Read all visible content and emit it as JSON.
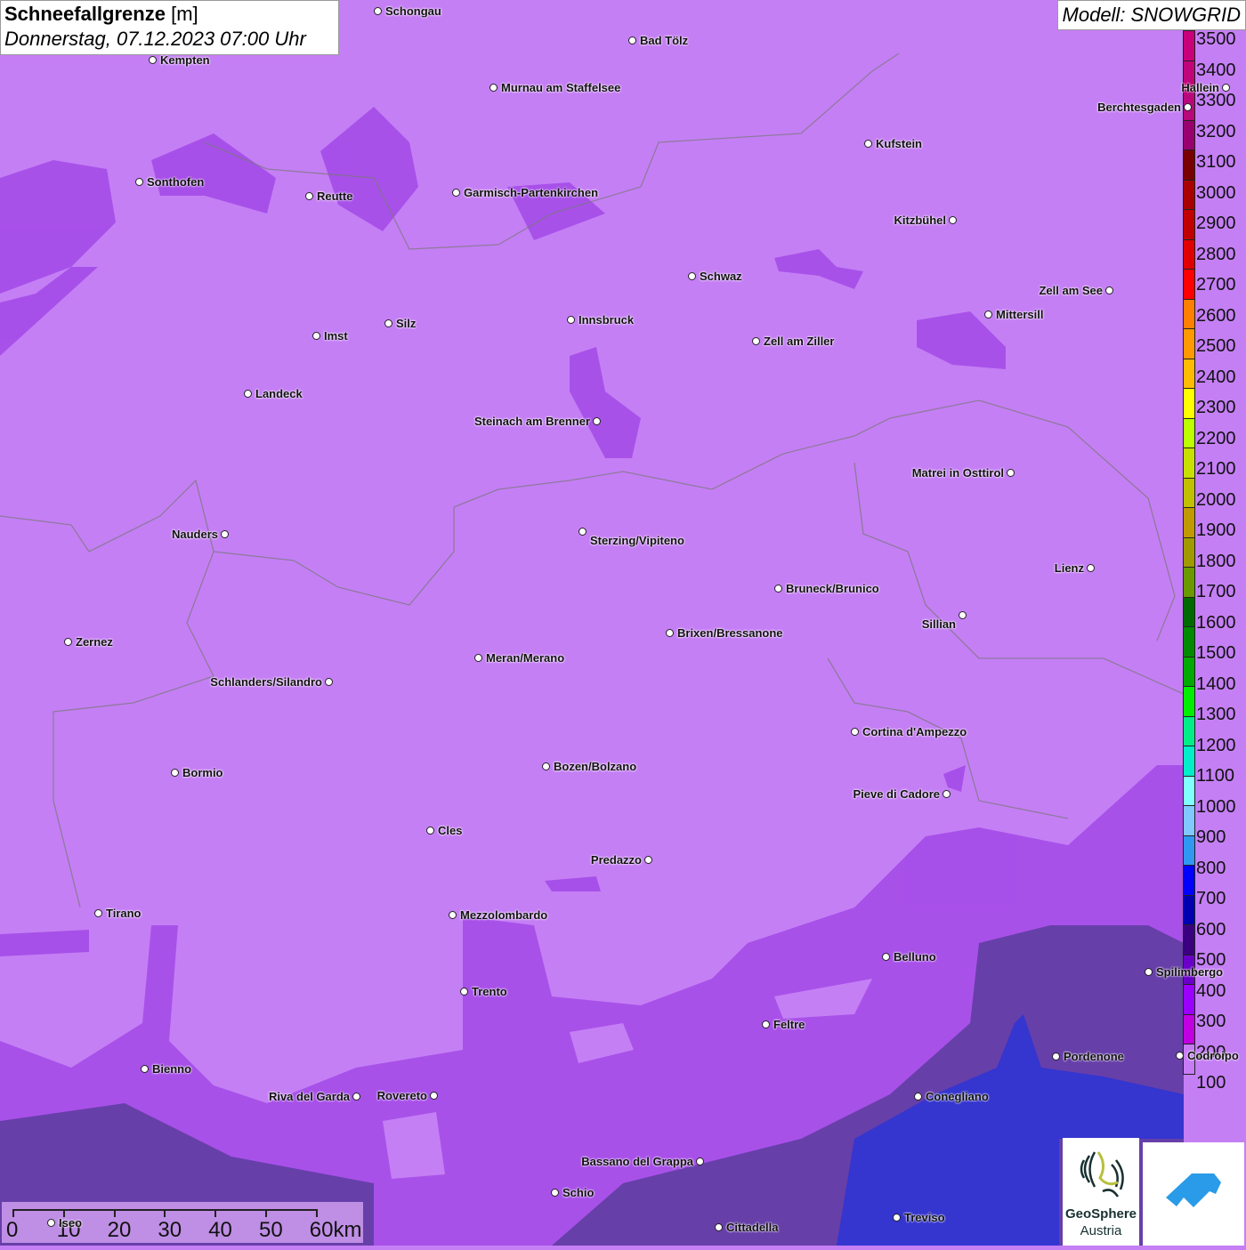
{
  "title": {
    "variable": "Schneefallgrenze",
    "unit": "[m]",
    "datetime": "Donnerstag, 07.12.2023 07:00 Uhr"
  },
  "model": "Modell: SNOWGRID",
  "legend": {
    "labels": [
      "3500",
      "3400",
      "3300",
      "3200",
      "3100",
      "3000",
      "2900",
      "2800",
      "2700",
      "2600",
      "2500",
      "2400",
      "2300",
      "2200",
      "2100",
      "2000",
      "1900",
      "1800",
      "1700",
      "1600",
      "1500",
      "1400",
      "1300",
      "1200",
      "1100",
      "1000",
      "900",
      "800",
      "700",
      "600",
      "500",
      "400",
      "300",
      "200",
      "100"
    ],
    "colors": [
      "#c8007a",
      "#c0057a",
      "#b8087a",
      "#98006e",
      "#780000",
      "#a80000",
      "#c00000",
      "#e00000",
      "#ff0000",
      "#ff7f00",
      "#ff9900",
      "#ffbb00",
      "#ffff00",
      "#bbff00",
      "#c8e000",
      "#c0c000",
      "#c09a00",
      "#a09a00",
      "#6a9a00",
      "#006a00",
      "#008a00",
      "#00aa00",
      "#00ee00",
      "#00ee88",
      "#00eec8",
      "#80ffff",
      "#80c8ff",
      "#3098f0",
      "#0000ff",
      "#0000b0",
      "#3a0080",
      "#6a00c8",
      "#9a00ff",
      "#c000e0",
      "#c77cf7"
    ]
  },
  "cities": [
    "Schongau",
    "Bad Tölz",
    "Kempten",
    "Murnau am Staffelsee",
    "Hallein",
    "Berchtesgaden",
    "Kufstein",
    "Sonthofen",
    "Reutte",
    "Garmisch-Partenkirchen",
    "Kitzbühel",
    "Schwaz",
    "Zell am See",
    "Innsbruck",
    "Mittersill",
    "Silz",
    "Imst",
    "Zell am Ziller",
    "Landeck",
    "Steinach am Brenner",
    "Matrei in Osttirol",
    "Nauders",
    "Sterzing/Vipiteno",
    "Lienz",
    "Bruneck/Brunico",
    "Sillian",
    "Brixen/Bressanone",
    "Zernez",
    "Meran/Merano",
    "Schlanders/Silandro",
    "Cortina d'Ampezzo",
    "Bozen/Bolzano",
    "Bormio",
    "Pieve di Cadore",
    "Cles",
    "Predazzo",
    "Tirano",
    "Mezzolombardo",
    "Belluno",
    "Spilimbergo",
    "Trento",
    "Feltre",
    "Pordenone",
    "Codroipo",
    "Bienno",
    "Riva del Garda",
    "Rovereto",
    "Conegliano",
    "Bassano del Grappa",
    "Schio",
    "Iseo",
    "Treviso",
    "Cittadella"
  ],
  "scale": {
    "labels": [
      "0",
      "10",
      "20",
      "30",
      "40",
      "50",
      "60km"
    ]
  },
  "logos": {
    "geosphere_line1": "GeoSphere",
    "geosphere_line2": "Austria"
  },
  "colors": {
    "base": "#c57ff5",
    "purple": "#a14ae6",
    "dark": "#5b3a9c",
    "blue": "#3838cf"
  }
}
